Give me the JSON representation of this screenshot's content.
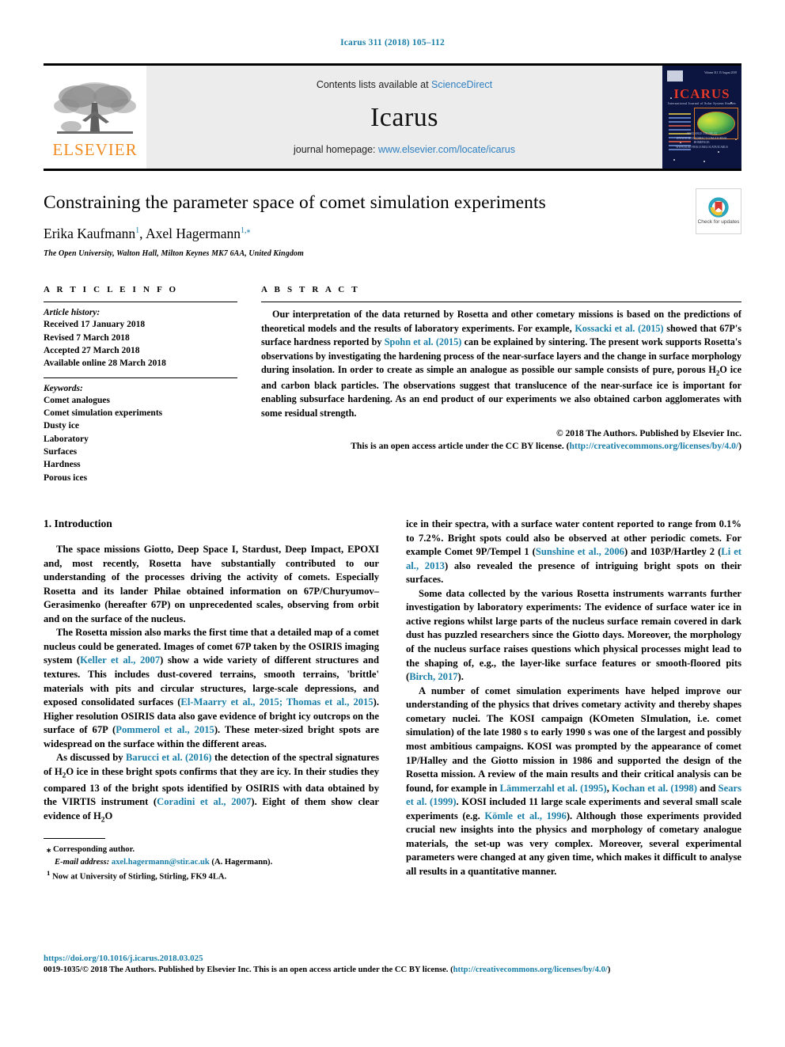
{
  "running_head": "Icarus 311 (2018) 105–112",
  "masthead": {
    "publisher_logo_label": "ELSEVIER",
    "contents_prefix": "Contents lists available at ",
    "contents_link": "ScienceDirect",
    "journal_name": "Icarus",
    "homepage_prefix": "journal homepage: ",
    "homepage_link": "www.elsevier.com/locate/icarus",
    "cover": {
      "title": "ICARUS",
      "subtitle": "International Journal of Solar System Studies",
      "bottom_text": "AVAILABLE ONLINE AT WWW.SCIENCEDIRECT.COM\nJOURNAL HOMEPAGE: WWW.ELSEVIER.COM/LOCATE/ICARUS",
      "top_right": "Volume 311  15 August 2018"
    }
  },
  "article": {
    "title": "Constraining the parameter space of comet simulation experiments",
    "authors": "Erika Kaufmann, Axel Hagermann",
    "author1": "Erika Kaufmann",
    "author1_sup": "1",
    "author2": "Axel Hagermann",
    "author2_sup": "1,",
    "affiliation": "The Open University, Walton Hall, Milton Keynes MK7 6AA, United Kingdom",
    "crossmark_label": "Check for\nupdates"
  },
  "article_info": {
    "heading": "A R T I C L E   I N F O",
    "history_label": "Article history:",
    "history": [
      "Received 17 January 2018",
      "Revised 7 March 2018",
      "Accepted 27 March 2018",
      "Available online 28 March 2018"
    ],
    "keywords_label": "Keywords:",
    "keywords": [
      "Comet analogues",
      "Comet simulation experiments",
      "Dusty ice",
      "Laboratory",
      "Surfaces",
      "Hardness",
      "Porous ices"
    ]
  },
  "abstract": {
    "heading": "A B S T R A C T",
    "text_parts": {
      "p1": "Our interpretation of the data returned by Rosetta and other cometary missions is based on the predictions of theoretical models and the results of laboratory experiments. For example, ",
      "ref1": "Kossacki et al. (2015)",
      "p2": " showed that 67P's surface hardness reported by ",
      "ref2": "Spohn et al. (2015)",
      "p3": " can be explained by sintering. The present work supports Rosetta's observations by investigating the hardening process of the near-surface layers and the change in surface morphology during insolation. In order to create as simple an analogue as possible our sample consists of pure, porous H",
      "sub1": "2",
      "p4": "O ice and carbon black particles. The observations suggest that translucence of the near-surface ice is important for enabling subsurface hardening. As an end product of our experiments we also obtained carbon agglomerates with some residual strength."
    },
    "copyright": "© 2018 The Authors. Published by Elsevier Inc.",
    "license_prefix": "This is an open access article under the CC BY license. (",
    "license_link": "http://creativecommons.org/licenses/by/4.0/",
    "license_suffix": ")"
  },
  "body": {
    "section1_title": "1. Introduction",
    "left_column": {
      "para1": "The space missions Giotto, Deep Space I, Stardust, Deep Impact, EPOXI and, most recently, Rosetta have substantially contributed to our understanding of the processes driving the activity of comets. Especially Rosetta and its lander Philae obtained information on 67P/Churyumov–Gerasimenko (hereafter 67P) on unprecedented scales, observing from orbit and on the surface of the nucleus.",
      "para2_a": "The Rosetta mission also marks the first time that a detailed map of a comet nucleus could be generated. Images of comet 67P taken by the OSIRIS imaging system (",
      "para2_ref1": "Keller et al., 2007",
      "para2_b": ") show a wide variety of different structures and textures. This includes dust-covered terrains, smooth terrains, 'brittle' materials with pits and circular structures, large-scale depressions, and exposed consolidated surfaces (",
      "para2_ref2": "El-Maarry et al., 2015; Thomas et al., 2015",
      "para2_c": "). Higher resolution OSIRIS data also gave evidence of bright icy outcrops on the surface of 67P (",
      "para2_ref3": "Pommerol et al., 2015",
      "para2_d": "). These meter-sized bright spots are widespread on the surface within the different areas.",
      "para3_a": "As discussed by ",
      "para3_ref1": "Barucci et al. (2016)",
      "para3_b": " the detection of the spectral signatures of H",
      "para3_sub": "2",
      "para3_c": "O ice in these bright spots confirms that they are icy. In their studies they compared 13 of the bright spots identified by OSIRIS with data obtained by the VIRTIS instrument (",
      "para3_ref2": "Coradini et al., 2007",
      "para3_d": "). Eight of them show clear evidence of H",
      "para3_sub2": "2",
      "para3_e": "O"
    },
    "right_column": {
      "para1_a": "ice in their spectra, with a surface water content reported to range from 0.1% to 7.2%. Bright spots could also be observed at other periodic comets. For example Comet 9P/Tempel 1 (",
      "para1_ref1": "Sunshine et al., 2006",
      "para1_b": ") and 103P/Hartley 2 (",
      "para1_ref2": "Li et al., 2013",
      "para1_c": ") also revealed the presence of intriguing bright spots on their surfaces.",
      "para2_a": "Some data collected by the various Rosetta instruments warrants further investigation by laboratory experiments: The evidence of surface water ice in active regions whilst large parts of the nucleus surface remain covered in dark dust has puzzled researchers since the Giotto days. Moreover, the morphology of the nucleus surface raises questions which physical processes might lead to the shaping of, e.g., the layer-like surface features or smooth-floored pits (",
      "para2_ref1": "Birch, 2017",
      "para2_b": ").",
      "para3_a": "A number of comet simulation experiments have helped improve our understanding of the physics that drives cometary activity and thereby shapes cometary nuclei. The KOSI campaign (KOmeten SImulation, i.e. comet simulation) of the late 1980 s to early 1990 s was one of the largest and possibly most ambitious campaigns. KOSI was prompted by the appearance of comet 1P/Halley and the Giotto mission in 1986 and supported the design of the Rosetta mission. A review of the main results and their critical analysis can be found, for example in ",
      "para3_ref1": "Lämmerzahl et al. (1995)",
      "para3_b": ", ",
      "para3_ref2": "Kochan et al. (1998)",
      "para3_c": " and ",
      "para3_ref3": "Sears et al. (1999)",
      "para3_d": ". KOSI included 11 large scale experiments and several small scale experiments (e.g. ",
      "para3_ref4": "Kömle et al., 1996",
      "para3_e": "). Although those experiments provided crucial new insights into the physics and morphology of cometary analogue materials, the set-up was very complex. Moreover, several experimental parameters were changed at any given time, which makes it difficult to analyse all results in a quantitative manner."
    }
  },
  "footnotes": {
    "star_marker": "⁎",
    "corresponding": "Corresponding author.",
    "email_label": "E-mail address:",
    "email": "axel.hagermann@stir.ac.uk",
    "email_attrib": "(A. Hagermann).",
    "fn1_marker": "1",
    "fn1_text": "Now at University of Stirling, Stirling, FK9 4LA."
  },
  "page_footer": {
    "doi": "https://doi.org/10.1016/j.icarus.2018.03.025",
    "issn_prefix": "0019-1035/",
    "issn_body": "© 2018 The Authors. Published by Elsevier Inc. This is an open access article under the CC BY license. (",
    "issn_link": "http://creativecommons.org/licenses/by/4.0/",
    "issn_suffix": ")"
  },
  "colors": {
    "link": "#1a7fa8",
    "elsevier_orange": "#f08c22",
    "masthead_grey": "#ececec"
  }
}
